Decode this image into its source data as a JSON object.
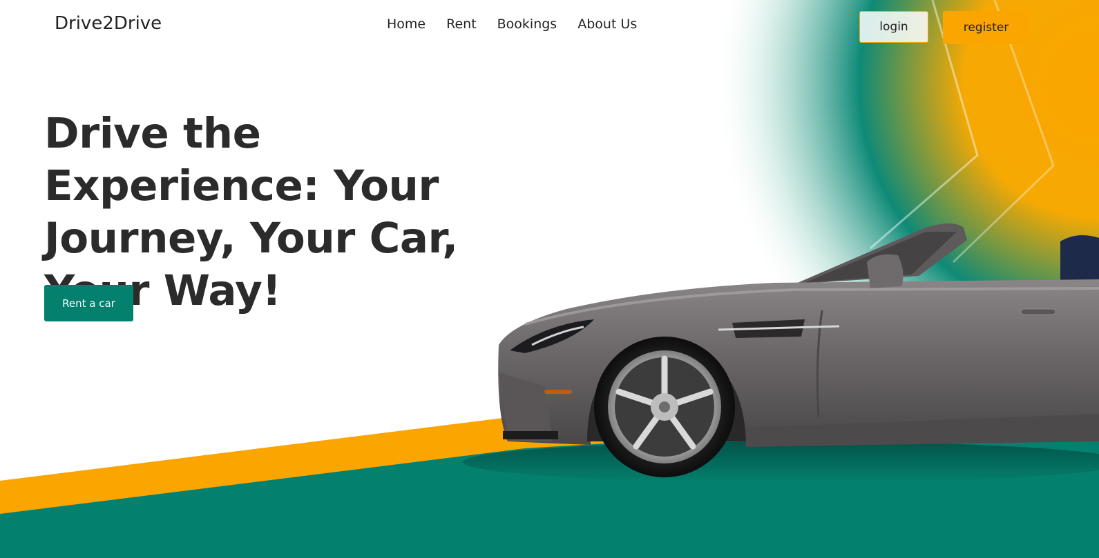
{
  "brand": {
    "name": "Drive2Drive"
  },
  "nav": {
    "items": [
      {
        "label": "Home"
      },
      {
        "label": "Rent"
      },
      {
        "label": "Bookings"
      },
      {
        "label": "About Us"
      }
    ]
  },
  "auth": {
    "login_label": "login",
    "register_label": "register"
  },
  "hero": {
    "title": "Drive the Experience: Your Journey, Your Car, Your Way!",
    "cta_label": "Rent a car",
    "image_subject": "car-image"
  },
  "colors": {
    "primary_teal": "#04806f",
    "accent_orange": "#fba500",
    "text_dark": "#2b2b2b",
    "background": "#ffffff"
  }
}
